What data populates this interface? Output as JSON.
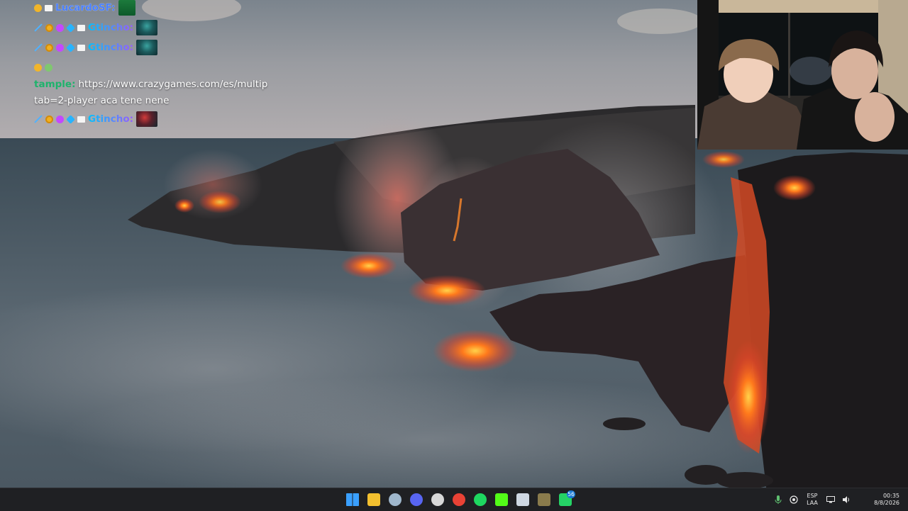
{
  "chat": {
    "messages": [
      {
        "badges": [
          "smile-icon",
          "card-icon"
        ],
        "user": "LucardoSF:",
        "emote": "green-emote"
      },
      {
        "badges": [
          "sword-icon",
          "coin-icon",
          "gem-icon",
          "diamond-icon",
          "card-icon"
        ],
        "user": "Gtincho:",
        "emote": "teal-emote"
      },
      {
        "badges": [
          "sword-icon",
          "coin-icon",
          "gem-icon",
          "diamond-icon",
          "card-icon"
        ],
        "user": "Gtincho:",
        "emote": "teal-emote"
      },
      {
        "badges": [
          "smile-icon",
          "frog-icon"
        ],
        "user": "",
        "emote": ""
      },
      {
        "user": "tample:",
        "text_line1": "https://www.crazygames.com/es/multip",
        "text_line2": "tab=2-player aca tene nene"
      },
      {
        "badges": [
          "sword-icon",
          "coin-icon",
          "gem-icon",
          "diamond-icon",
          "card-icon"
        ],
        "user": "Gtincho:",
        "emote": "red-emote"
      }
    ]
  },
  "taskbar": {
    "apps": [
      {
        "name": "windows-start-icon",
        "color": "#3aa0ff"
      },
      {
        "name": "file-explorer-icon",
        "color": "#f3c02f"
      },
      {
        "name": "steam-icon",
        "color": "#9fb7cc"
      },
      {
        "name": "discord-icon",
        "color": "#5865f2"
      },
      {
        "name": "obs-icon",
        "color": "#d8d8d8"
      },
      {
        "name": "chrome-icon",
        "color": "#e94235"
      },
      {
        "name": "spotify-icon",
        "color": "#1ed760"
      },
      {
        "name": "kick-icon",
        "color": "#53fc18"
      },
      {
        "name": "cursor-app-icon",
        "color": "#cfd8e3"
      },
      {
        "name": "minecraft-icon",
        "color": "#8a7b4c"
      },
      {
        "name": "whatsapp-icon",
        "color": "#25d366",
        "badge": "56"
      }
    ],
    "tray": {
      "language_line1": "ESP",
      "language_line2": "LAA",
      "time": "00:35",
      "date": "8/8/2026"
    }
  }
}
